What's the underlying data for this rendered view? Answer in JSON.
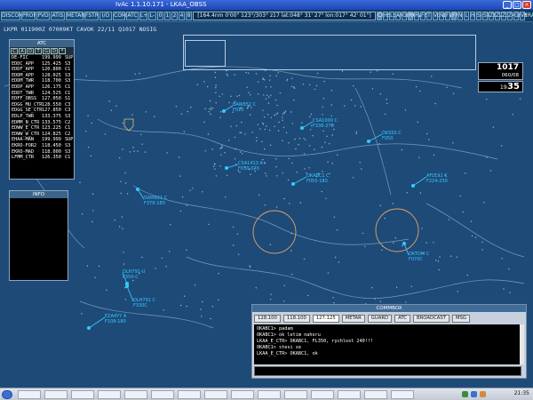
{
  "window": {
    "title": "IvAc 1.1.10.171 - LKAA_OBSS"
  },
  "toolbar": {
    "buttons": [
      "DISCON",
      "PROF",
      "PVD",
      "ATIS",
      "METAR",
      "FSTR",
      "I/O",
      "COM",
      "ATC",
      "L+",
      "L-",
      "0",
      "1",
      "2",
      "4",
      "8",
      "CH",
      "HS",
      "LS",
      "AP",
      "GEO",
      "RR",
      "RWY",
      "FCL",
      "T",
      "VOR",
      "NDB",
      "FIX",
      "FRQ",
      "N",
      "L",
      "H",
      "SID",
      "STAR",
      "Z1",
      "Z2",
      "Z3",
      "Z4",
      "GDM",
      "VERA"
    ],
    "active": [
      "CH",
      "RR",
      "FRQ"
    ],
    "range": "[164.4nm",
    "heading": "0'00\"",
    "bearing": "123°/303°",
    "zoom": "z17",
    "coords": "lat:048° 31' 27\" lon:017° 42' 01\"]"
  },
  "metar": {
    "text": "LKPR 011900Z 07009KT CAVOK 22/11 Q1017 NOSIG"
  },
  "atc_panel": {
    "title": "ATC",
    "tabs": [
      "C",
      "A",
      "D",
      "T",
      "G",
      "D",
      "*"
    ],
    "rows": [
      {
        "callsign": "DE-FIC",
        "freq": "199.999",
        "rating": "SUP"
      },
      {
        "callsign": "EDDC_APP",
        "freq": "125.425",
        "rating": "S3"
      },
      {
        "callsign": "EDDF_APP",
        "freq": "120.800",
        "rating": "C1"
      },
      {
        "callsign": "EDDM_APP",
        "freq": "128.025",
        "rating": "S3"
      },
      {
        "callsign": "EDDM_TWR",
        "freq": "118.700",
        "rating": "S3"
      },
      {
        "callsign": "EDDP_APP",
        "freq": "126.175",
        "rating": "C1"
      },
      {
        "callsign": "EDDT_TWR",
        "freq": "124.525",
        "rating": "C1"
      },
      {
        "callsign": "EDFF_OBSS",
        "freq": "127.050",
        "rating": "S1"
      },
      {
        "callsign": "EDGG_MU_CTR",
        "freq": "128.550",
        "rating": "C3"
      },
      {
        "callsign": "EDGG_SE_CTR",
        "freq": "127.850",
        "rating": "C3"
      },
      {
        "callsign": "EDLP_TWR",
        "freq": "133.375",
        "rating": "S3"
      },
      {
        "callsign": "EDMM_N_CTR",
        "freq": "133.575",
        "rating": "C2"
      },
      {
        "callsign": "EDWW_E_CTR",
        "freq": "123.225",
        "rating": "C1"
      },
      {
        "callsign": "EDWW_W_CTR",
        "freq": "124.825",
        "rating": "C2"
      },
      {
        "callsign": "EHAA-MAN",
        "freq": "199.999",
        "rating": "SUP"
      },
      {
        "callsign": "EKRO-FOR2",
        "freq": "118.450",
        "rating": "S3"
      },
      {
        "callsign": "EKRO-MAD",
        "freq": "118.000",
        "rating": "S3"
      },
      {
        "callsign": "LFMM_CTR",
        "freq": "126.350",
        "rating": "C1"
      }
    ]
  },
  "info_panel": {
    "title": "INFO"
  },
  "status": {
    "qnh": "1017",
    "wind": "060/08",
    "clock_hour": "19",
    "clock_min": "35"
  },
  "comms": {
    "title": "COMMBOX",
    "tabs": [
      "128.100",
      "118.100",
      "127.125",
      "METAR",
      "GUARD",
      "ATC",
      "BROADCAST",
      "MSG"
    ],
    "lines": [
      "OKABC1> padam",
      "OKABC1> ok letim nahoru",
      "LKAA_E_CTR> OKABC1, FL350, rychlost 240!!!",
      "OKABC1> stesi se",
      "LKAA_E_CTR> OKABC1, ok"
    ]
  },
  "aircraft": [
    {
      "callsign": "AFL192 C",
      "data": "F224-230"
    },
    {
      "callsign": "CSA1000 C",
      "data": "F336-270"
    },
    {
      "callsign": "CSA1413 A",
      "data": "F030-070"
    },
    {
      "callsign": "DLH791 C",
      "data": "F330C"
    },
    {
      "callsign": "DLH791-U",
      "data": "F350-C"
    },
    {
      "callsign": "EZA4YY A",
      "data": "F108-180"
    },
    {
      "callsign": "OKABC1 C",
      "data": "F055-180"
    },
    {
      "callsign": "OKTOM C",
      "data": "F070C"
    },
    {
      "callsign": "SWR821 C",
      "data": "F378-180"
    },
    {
      "callsign": "BAW852 C",
      "data": "F010"
    },
    {
      "callsign": "OKSSS C",
      "data": "F050"
    }
  ],
  "colors": {
    "background": "#1e4a78",
    "aircraft": "#35c8ff",
    "boundary": "#8fb0cc",
    "circle": "#e2a36a"
  },
  "taskbar": {
    "clock": "21:35"
  }
}
